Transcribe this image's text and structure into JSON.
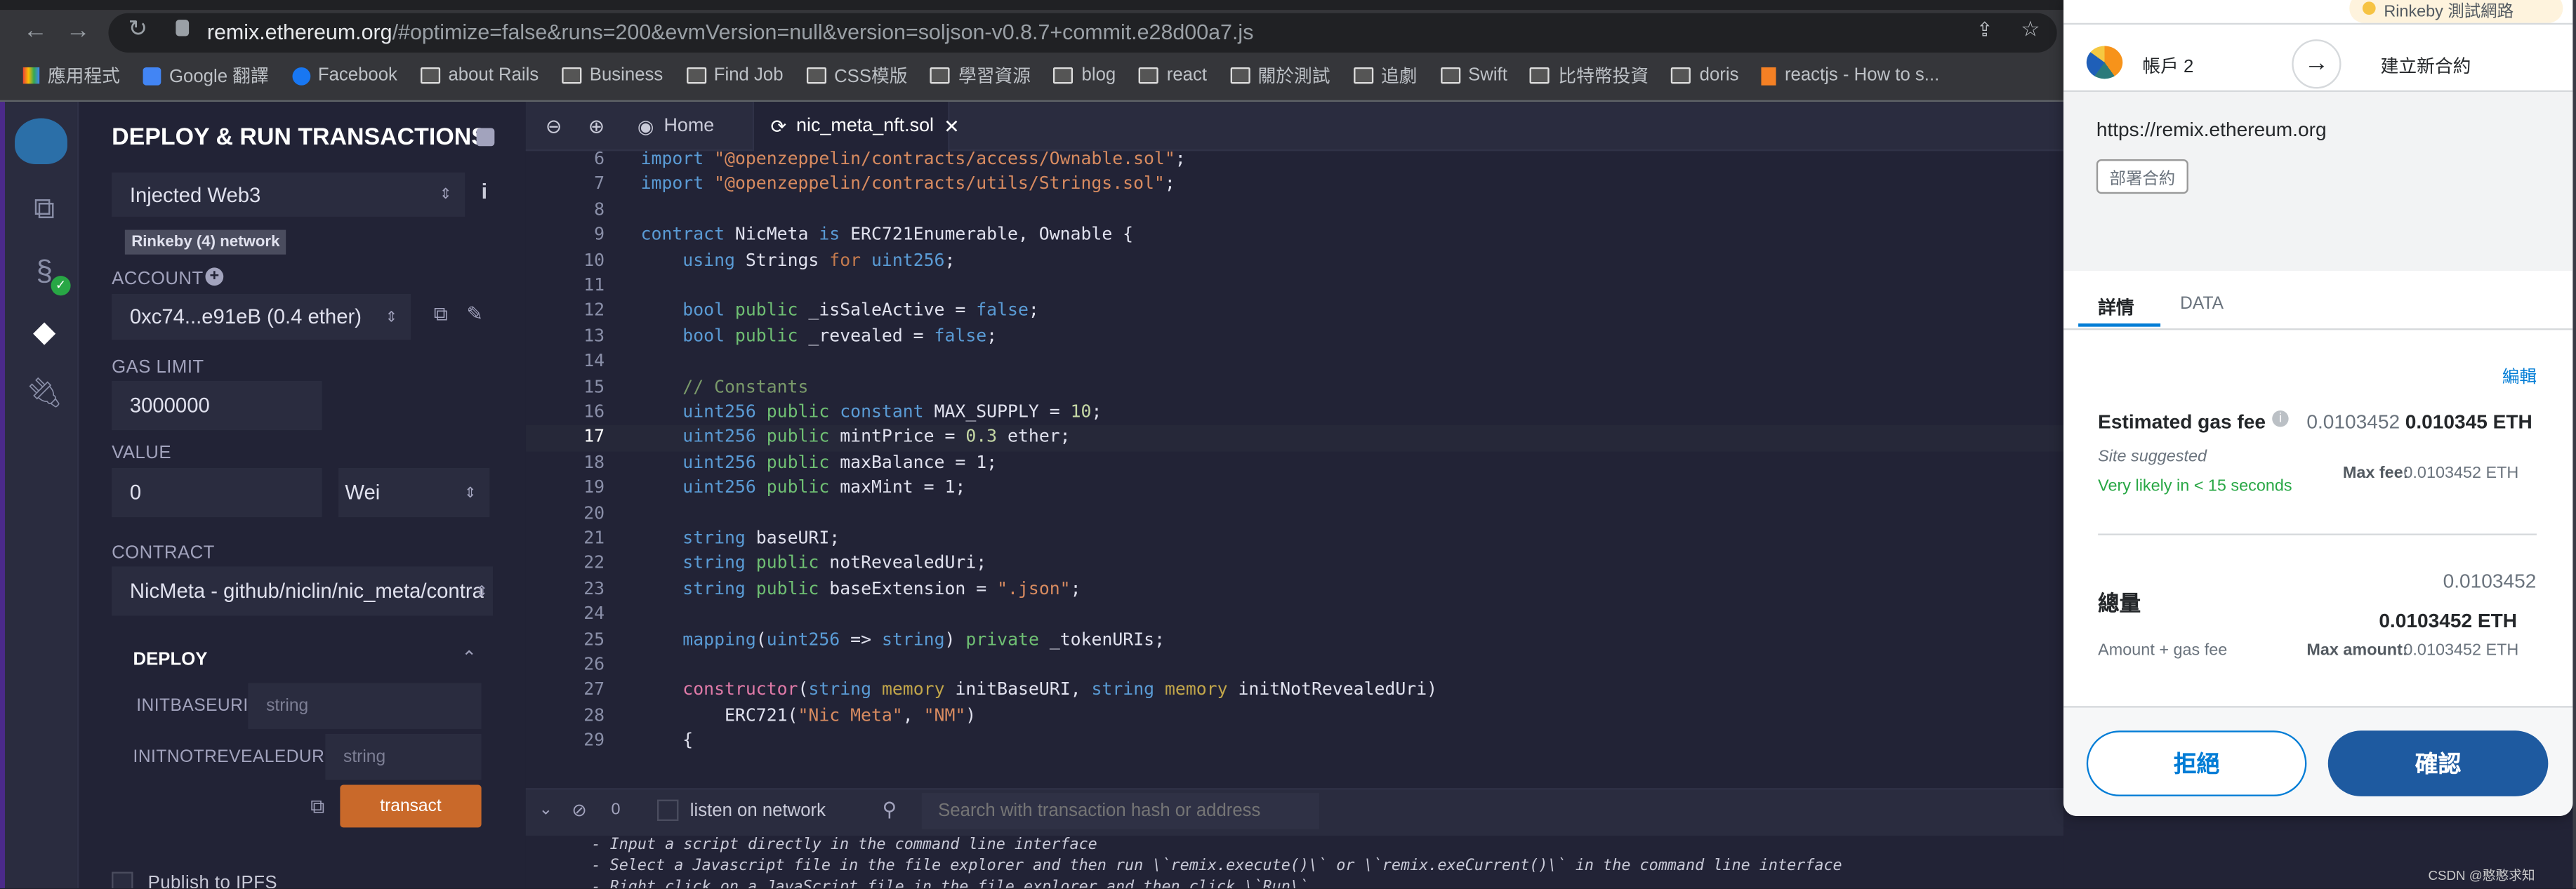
{
  "browser": {
    "url_host": "remix.ethereum.org",
    "url_rest": "/#optimize=false&runs=200&evmVersion=null&version=soljson-v0.8.7+commit.e28d00a7.js",
    "bookmarks": [
      "應用程式",
      "Google 翻譯",
      "Facebook",
      "about Rails",
      "Business",
      "Find Job",
      "CSS模版",
      "學習資源",
      "blog",
      "react",
      "關於測試",
      "追劇",
      "Swift",
      "比特幣投資",
      "doris",
      "reactjs - How to s..."
    ]
  },
  "side": {
    "title": "DEPLOY & RUN TRANSACTIONS",
    "environment": "Injected Web3",
    "network_badge": "Rinkeby (4) network",
    "account_label": "ACCOUNT",
    "account": "0xc74...e91eB (0.4 ether)",
    "gas_label": "GAS LIMIT",
    "gas": "3000000",
    "value_label": "VALUE",
    "value": "0",
    "unit": "Wei",
    "contract_label": "CONTRACT",
    "contract": "NicMeta - github/niclin/nic_meta/contra",
    "deploy_label": "DEPLOY",
    "params": [
      {
        "label": "INITBASEURI:",
        "placeholder": "string"
      },
      {
        "label": "INITNOTREVEALEDURI:",
        "placeholder": "string"
      }
    ],
    "transact": "transact",
    "publish": "Publish to IPFS"
  },
  "editor": {
    "tabs": {
      "home": "Home",
      "file": "nic_meta_nft.sol"
    },
    "active_line": 17,
    "lines": [
      {
        "n": "6",
        "s": [
          {
            "c": "kw",
            "t": "import "
          },
          {
            "c": "str",
            "t": "\"@openzeppelin/contracts/access/Ownable.sol\""
          },
          {
            "c": "",
            "t": ";"
          }
        ]
      },
      {
        "n": "7",
        "s": [
          {
            "c": "kw",
            "t": "import "
          },
          {
            "c": "str",
            "t": "\"@openzeppelin/contracts/utils/Strings.sol\""
          },
          {
            "c": "",
            "t": ";"
          }
        ]
      },
      {
        "n": "8",
        "s": []
      },
      {
        "n": "9",
        "s": [
          {
            "c": "kw",
            "t": "contract "
          },
          {
            "c": "",
            "t": "NicMeta "
          },
          {
            "c": "kw",
            "t": "is "
          },
          {
            "c": "",
            "t": "ERC721Enumerable, Ownable {"
          }
        ]
      },
      {
        "n": "10",
        "s": [
          {
            "c": "",
            "t": "    "
          },
          {
            "c": "kw",
            "t": "using "
          },
          {
            "c": "",
            "t": "Strings "
          },
          {
            "c": "ctl",
            "t": "for "
          },
          {
            "c": "kw",
            "t": "uint256"
          },
          {
            "c": "",
            "t": ";"
          }
        ]
      },
      {
        "n": "11",
        "s": []
      },
      {
        "n": "12",
        "s": [
          {
            "c": "",
            "t": "    "
          },
          {
            "c": "kw",
            "t": "bool "
          },
          {
            "c": "pub",
            "t": "public "
          },
          {
            "c": "",
            "t": "_isSaleActive = "
          },
          {
            "c": "kw",
            "t": "false"
          },
          {
            "c": "",
            "t": ";"
          }
        ]
      },
      {
        "n": "13",
        "s": [
          {
            "c": "",
            "t": "    "
          },
          {
            "c": "kw",
            "t": "bool "
          },
          {
            "c": "pub",
            "t": "public "
          },
          {
            "c": "",
            "t": "_revealed = "
          },
          {
            "c": "kw",
            "t": "false"
          },
          {
            "c": "",
            "t": ";"
          }
        ]
      },
      {
        "n": "14",
        "s": []
      },
      {
        "n": "15",
        "s": [
          {
            "c": "",
            "t": "    "
          },
          {
            "c": "cm",
            "t": "// Constants"
          }
        ]
      },
      {
        "n": "16",
        "s": [
          {
            "c": "",
            "t": "    "
          },
          {
            "c": "kw",
            "t": "uint256 "
          },
          {
            "c": "pub",
            "t": "public "
          },
          {
            "c": "kw",
            "t": "constant "
          },
          {
            "c": "",
            "t": "MAX_SUPPLY = "
          },
          {
            "c": "num2",
            "t": "10"
          },
          {
            "c": "",
            "t": ";"
          }
        ]
      },
      {
        "n": "17",
        "s": [
          {
            "c": "",
            "t": "    "
          },
          {
            "c": "kw",
            "t": "uint256 "
          },
          {
            "c": "pub",
            "t": "public "
          },
          {
            "c": "",
            "t": "mintPrice = "
          },
          {
            "c": "num2",
            "t": "0.3"
          },
          {
            "c": "",
            "t": " ether;"
          }
        ]
      },
      {
        "n": "18",
        "s": [
          {
            "c": "",
            "t": "    "
          },
          {
            "c": "kw",
            "t": "uint256 "
          },
          {
            "c": "pub",
            "t": "public "
          },
          {
            "c": "",
            "t": "maxBalance = 1;"
          }
        ]
      },
      {
        "n": "19",
        "s": [
          {
            "c": "",
            "t": "    "
          },
          {
            "c": "kw",
            "t": "uint256 "
          },
          {
            "c": "pub",
            "t": "public "
          },
          {
            "c": "",
            "t": "maxMint = 1;"
          }
        ]
      },
      {
        "n": "20",
        "s": []
      },
      {
        "n": "21",
        "s": [
          {
            "c": "",
            "t": "    "
          },
          {
            "c": "kw",
            "t": "string "
          },
          {
            "c": "",
            "t": "baseURI;"
          }
        ]
      },
      {
        "n": "22",
        "s": [
          {
            "c": "",
            "t": "    "
          },
          {
            "c": "kw",
            "t": "string "
          },
          {
            "c": "pub",
            "t": "public "
          },
          {
            "c": "",
            "t": "notRevealedUri;"
          }
        ]
      },
      {
        "n": "23",
        "s": [
          {
            "c": "",
            "t": "    "
          },
          {
            "c": "kw",
            "t": "string "
          },
          {
            "c": "pub",
            "t": "public "
          },
          {
            "c": "",
            "t": "baseExtension = "
          },
          {
            "c": "str",
            "t": "\".json\""
          },
          {
            "c": "",
            "t": ";"
          }
        ]
      },
      {
        "n": "24",
        "s": []
      },
      {
        "n": "25",
        "s": [
          {
            "c": "",
            "t": "    "
          },
          {
            "c": "kw",
            "t": "mapping"
          },
          {
            "c": "",
            "t": "("
          },
          {
            "c": "kw",
            "t": "uint256"
          },
          {
            "c": "",
            "t": " => "
          },
          {
            "c": "kw",
            "t": "string"
          },
          {
            "c": "",
            "t": ") "
          },
          {
            "c": "pub",
            "t": "private "
          },
          {
            "c": "",
            "t": "_tokenURIs;"
          }
        ]
      },
      {
        "n": "26",
        "s": []
      },
      {
        "n": "27",
        "s": [
          {
            "c": "",
            "t": "    "
          },
          {
            "c": "ctor",
            "t": "constructor"
          },
          {
            "c": "",
            "t": "("
          },
          {
            "c": "kw",
            "t": "string "
          },
          {
            "c": "mem",
            "t": "memory "
          },
          {
            "c": "",
            "t": "initBaseURI, "
          },
          {
            "c": "kw",
            "t": "string "
          },
          {
            "c": "mem",
            "t": "memory "
          },
          {
            "c": "",
            "t": "initNotRevealedUri)"
          }
        ]
      },
      {
        "n": "28",
        "s": [
          {
            "c": "",
            "t": "        ERC721("
          },
          {
            "c": "str",
            "t": "\"Nic Meta\""
          },
          {
            "c": "",
            "t": ", "
          },
          {
            "c": "str",
            "t": "\"NM\""
          },
          {
            "c": "",
            "t": ")"
          }
        ]
      },
      {
        "n": "29",
        "s": [
          {
            "c": "",
            "t": "    {"
          }
        ]
      }
    ]
  },
  "terminal": {
    "count": "0",
    "listen": "listen on network",
    "search_placeholder": "Search with transaction hash or address",
    "lines": [
      "- Input a script directly in the command line interface",
      "- Select a Javascript file in the file explorer and then run \\`remix.execute()\\` or \\`remix.exeCurrent()\\`  in the command line interface",
      "- Right click on a JavaScript file in the file explorer and then click \\`Run\\`"
    ]
  },
  "metamask": {
    "network": "Rinkeby 測試網路",
    "account": "帳戶 2",
    "action": "建立新合約",
    "origin": "https://remix.ethereum.org",
    "type_badge": "部署合約",
    "tabs": [
      "詳情",
      "DATA"
    ],
    "edit": "編輯",
    "gas_label": "Estimated gas fee",
    "gas_fiat": "0.0103452",
    "gas_eth": "0.010345 ETH",
    "site_suggested": "Site suggested",
    "likely": "Very likely in < 15 seconds",
    "max_fee_label": "Max fee:",
    "max_fee": "0.0103452 ETH",
    "total_label": "總量",
    "total_fiat": "0.0103452",
    "total_eth": "0.0103452 ETH",
    "amount_gas": "Amount + gas fee",
    "max_amount_label": "Max amount:",
    "max_amount": "0.0103452 ETH",
    "reject": "拒絕",
    "confirm": "確認",
    "colors": {
      "primary": "#037dd6",
      "confirm": "#1e5aa0",
      "success": "#28a745"
    }
  },
  "watermark": "CSDN @憨憨求知"
}
